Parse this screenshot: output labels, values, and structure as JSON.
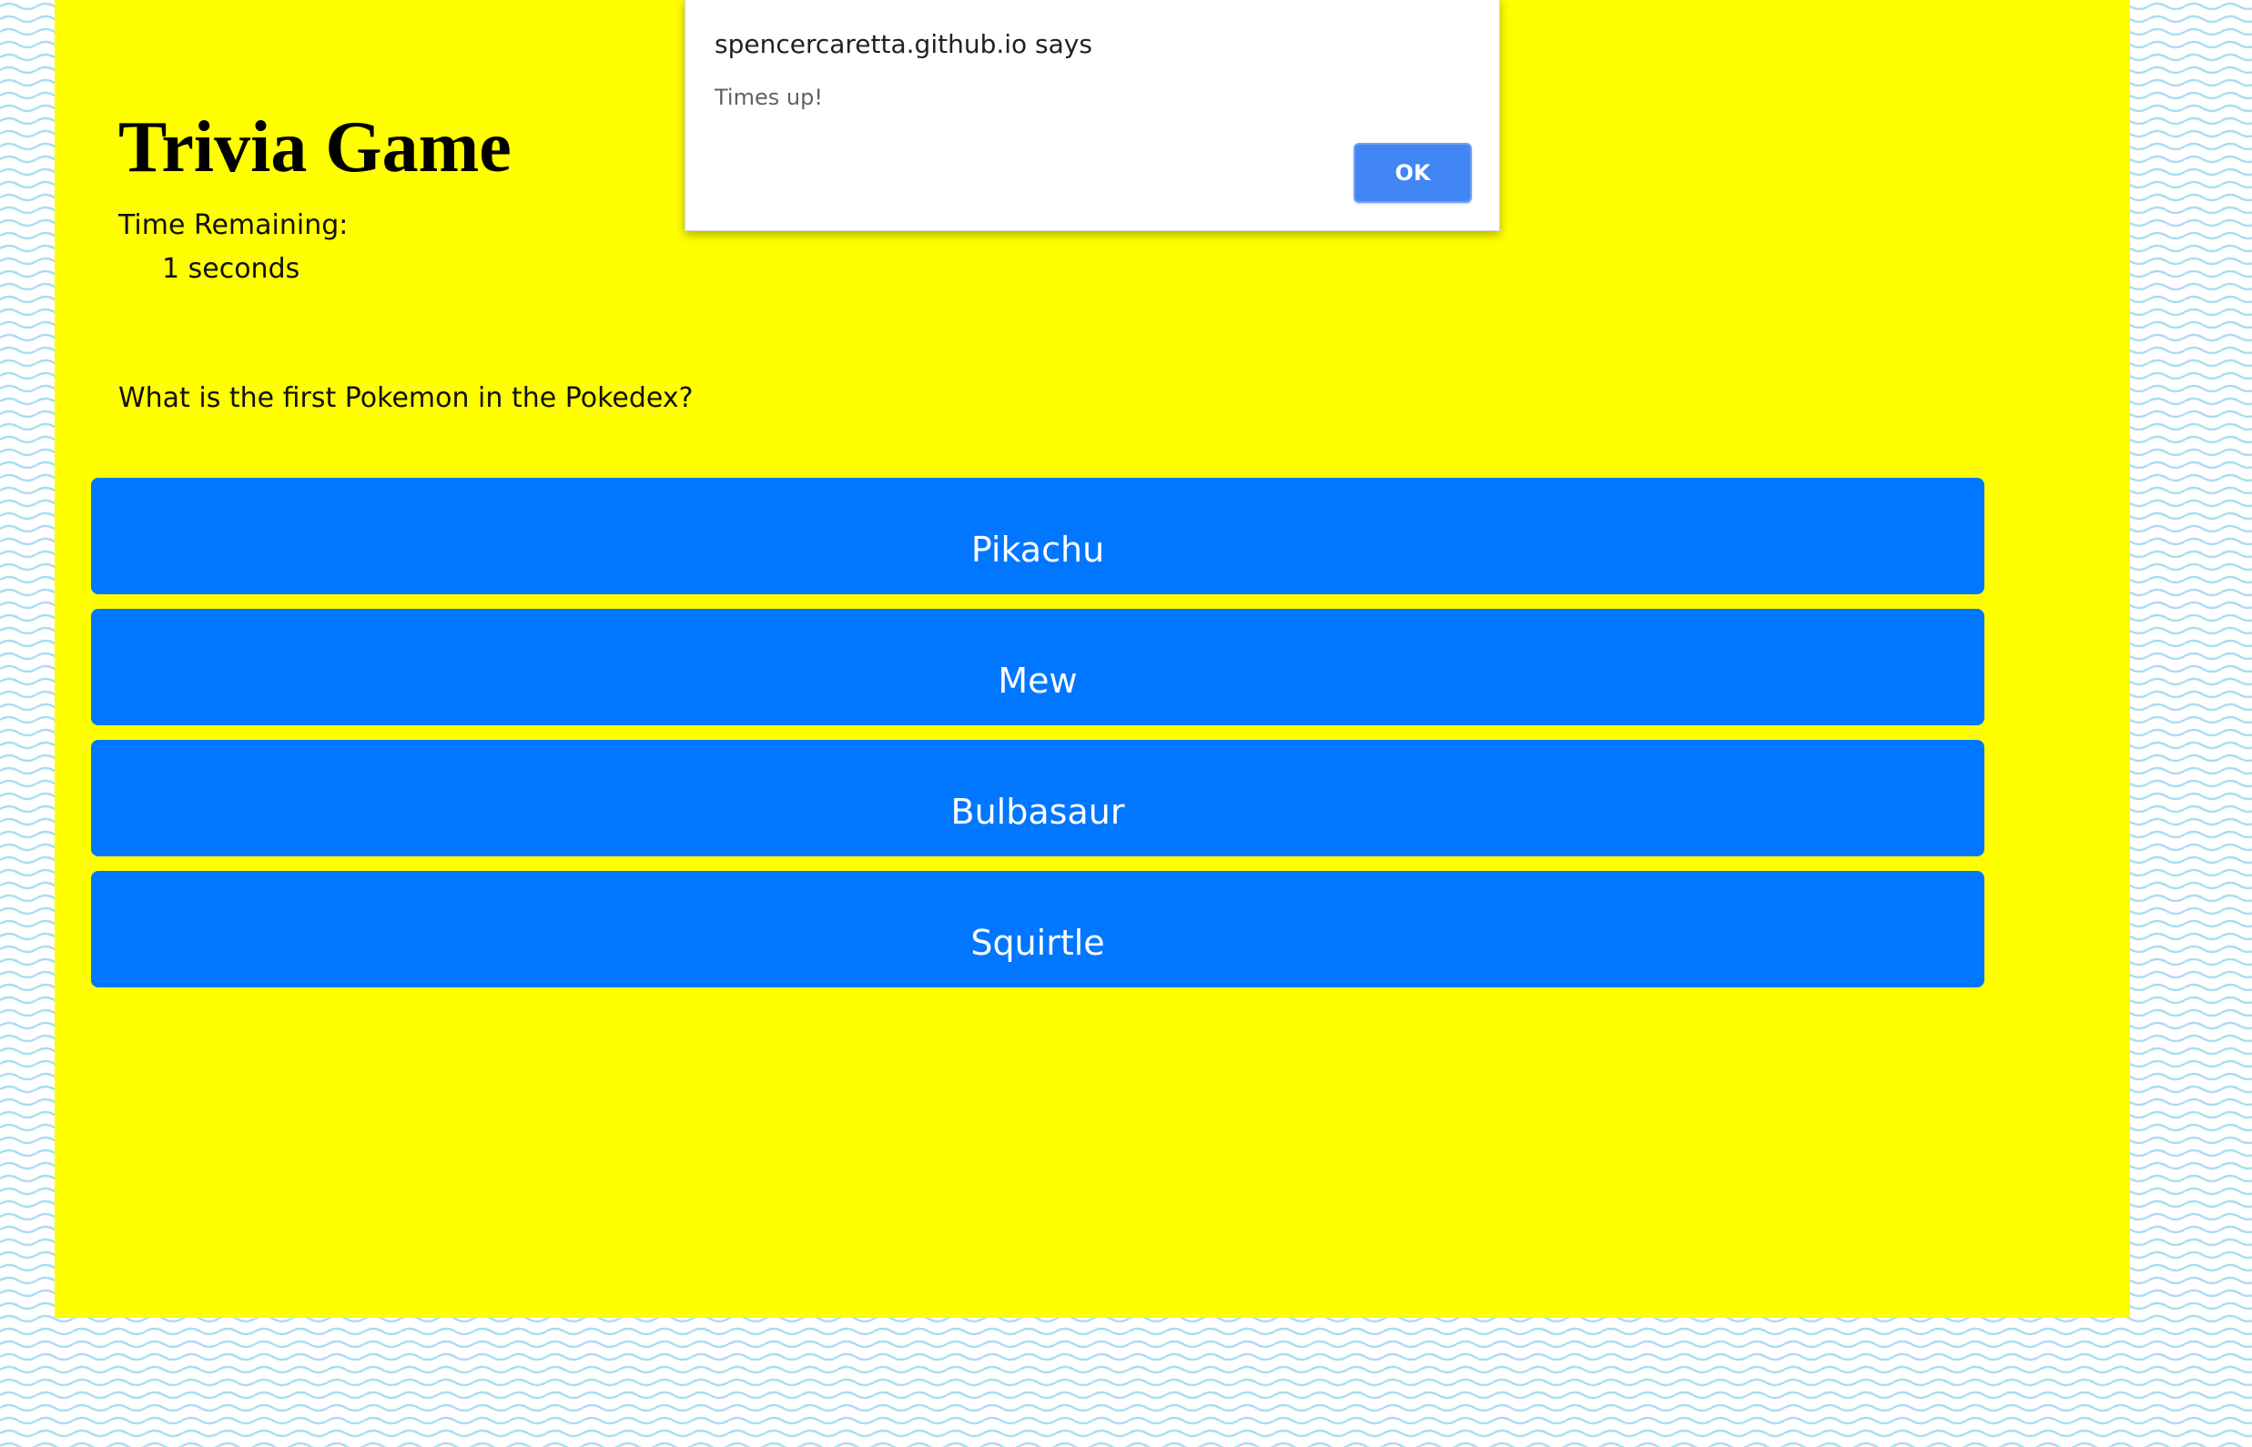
{
  "page": {
    "title": "Trivia Game",
    "timer_label": "Time Remaining:",
    "timer_value": "1 seconds",
    "question": "What is the first Pokemon in the Pokedex?",
    "answers": [
      {
        "label": "Pikachu"
      },
      {
        "label": "Mew"
      },
      {
        "label": "Bulbasaur"
      },
      {
        "label": "Squirtle"
      }
    ]
  },
  "alert": {
    "heading": "spencercaretta.github.io says",
    "message": "Times up!",
    "ok_label": "OK"
  },
  "colors": {
    "panel_background": "#ffff00",
    "answer_button": "#0177ff",
    "answer_text": "#ffffff",
    "dialog_button": "#4285f4",
    "wave_pattern": "#a9ddf2"
  }
}
